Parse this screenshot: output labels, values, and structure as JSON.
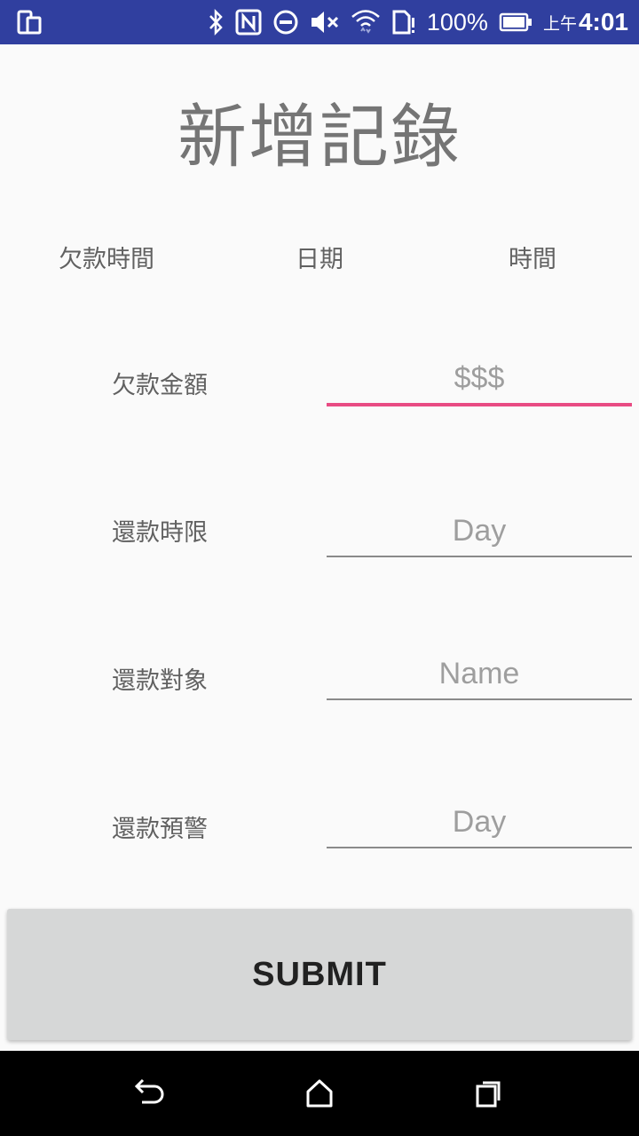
{
  "status_bar": {
    "battery_percent": "100%",
    "time_prefix": "上午",
    "time": "4:01",
    "background_color": "#303f9f",
    "icons": [
      "screen-mirror-icon",
      "bluetooth-icon",
      "nfc-icon",
      "do-not-disturb-icon",
      "mute-icon",
      "wifi-icon",
      "sim-alert-icon",
      "battery-icon"
    ]
  },
  "title": "新增記錄",
  "datetime_row": {
    "label": "欠款時間",
    "date": "日期",
    "time": "時間"
  },
  "form": {
    "amount": {
      "label": "欠款金額",
      "placeholder": "$$$"
    },
    "deadline": {
      "label": "還款時限",
      "placeholder": "Day"
    },
    "payee": {
      "label": "還款對象",
      "placeholder": "Name"
    },
    "warning": {
      "label": "還款預警",
      "placeholder": "Day"
    }
  },
  "submit_label": "SUBMIT",
  "accent_color": "#e84b83",
  "nav_bar": {
    "icons": [
      "back-icon",
      "home-icon",
      "recents-icon"
    ]
  }
}
